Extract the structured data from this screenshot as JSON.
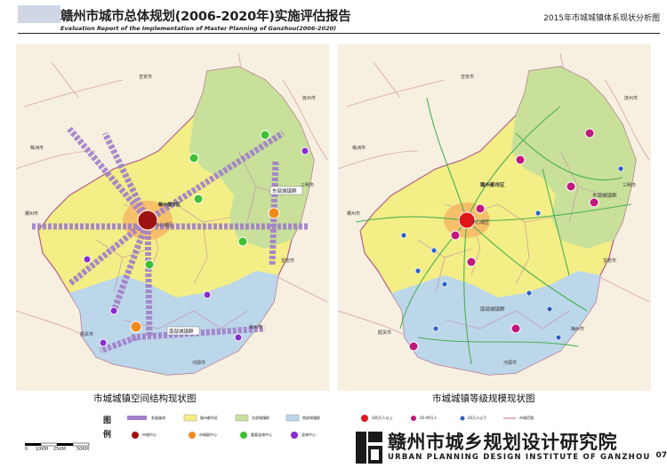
{
  "header": {
    "title": "赣州市城市总体规划(2006-2020年)实施评估报告",
    "subtitle": "Evaluation Report of the Implementation of Master Planning of Ganzhou(2006-2020)",
    "map_title": "2015年市城城镇体系现状分析图"
  },
  "map_left": {
    "caption": "市城城镇空间结构现状图",
    "labels": {
      "jian": "吉安市",
      "zhuzhou": "株洲市",
      "chenzhou": "郴州市",
      "shaoguan": "韶关市",
      "heyuan": "河源市",
      "meizhou": "梅州市",
      "longyan": "龙岩市",
      "sanming": "三明市",
      "fuzhou": "抚州市",
      "metro": "赣州都市区",
      "east_group": "东部城镇群",
      "south_group": "南部城镇群",
      "center": "中心城区"
    }
  },
  "map_right": {
    "caption": "市城城镇等级规模现状图",
    "labels": {
      "jian": "吉安市",
      "zhuzhou": "株洲市",
      "chenzhou": "郴州市",
      "shaoguan": "韶关市",
      "heyuan": "河源市",
      "meizhou": "梅州市",
      "longyan": "龙岩市",
      "sanming": "三明市",
      "fuzhou": "抚州市",
      "metro": "赣州都市区",
      "east_group": "东部城镇群",
      "south_group": "南部城镇群",
      "center": "中心城区"
    }
  },
  "legend": {
    "title_1": "图",
    "title_2": "例",
    "items_row1": [
      "发展轴线",
      "赣州都市区",
      "东部城镇群",
      "南部城镇群",
      "100万人以上",
      "20-49万人",
      "20万人以下",
      "市域范围"
    ],
    "items_row2": [
      "市域中心",
      "市域副中心",
      "重要县域中心",
      "县域中心"
    ]
  },
  "scale": {
    "labels": [
      "0",
      "10KM",
      "25KM",
      "50KM"
    ]
  },
  "footer": {
    "institute_cn": "赣州市城乡规划设计研究院",
    "institute_en": "URBAN PLANNING DESIGN INSTITUTE OF GANZHOU",
    "page": "07"
  },
  "colors": {
    "metro_zone": "#f3ee86",
    "east_zone": "#c8e09a",
    "south_zone": "#bcd6ea",
    "outside": "#f7f0e0",
    "axis": "#a17fc9",
    "center_node": "#a01313",
    "sub_center_node": "#f08a1c",
    "county_important": "#3fbf35",
    "county": "#8a2bd0",
    "road": "#4caf50",
    "boundary": "#c86496"
  }
}
